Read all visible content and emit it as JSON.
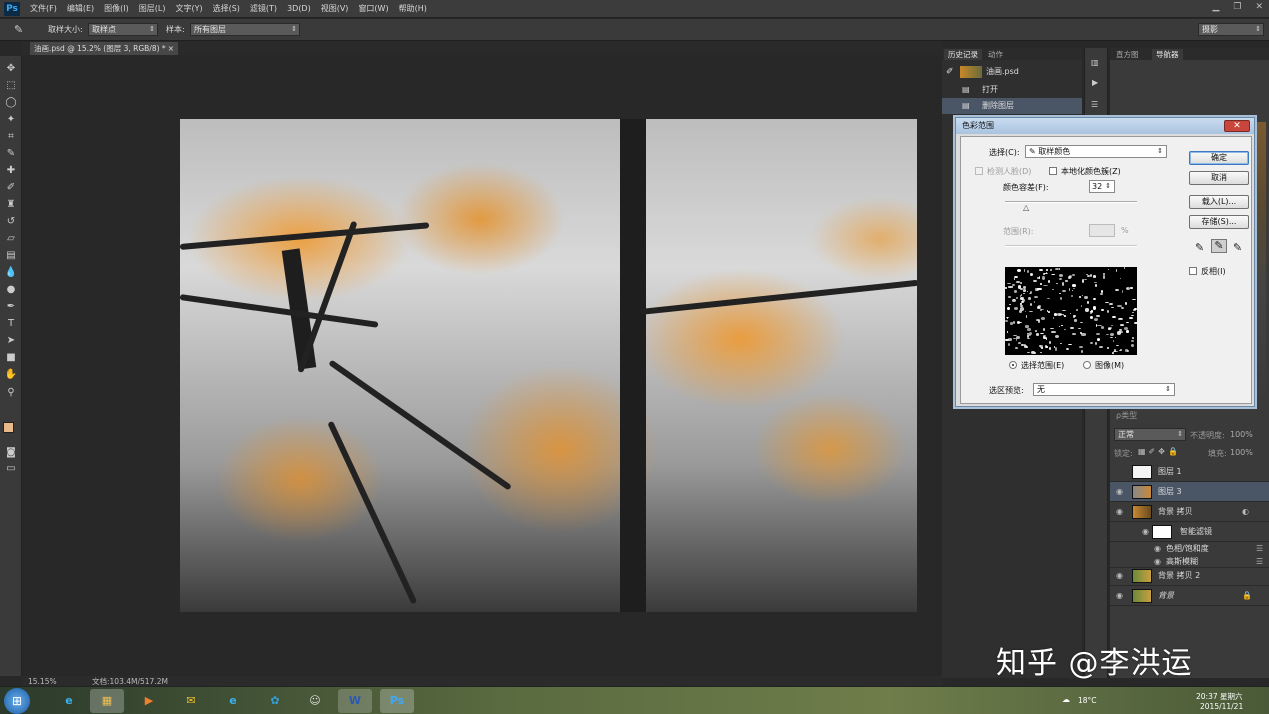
{
  "app": {
    "logo": "Ps",
    "menus": [
      "文件(F)",
      "编辑(E)",
      "图像(I)",
      "图层(L)",
      "文字(Y)",
      "选择(S)",
      "滤镜(T)",
      "3D(D)",
      "视图(V)",
      "窗口(W)",
      "帮助(H)"
    ],
    "window_controls": [
      "▁",
      "❐",
      "✕"
    ]
  },
  "options_bar": {
    "sample_size_label": "取样大小:",
    "sample_size_value": "取样点",
    "sample_label": "样本:",
    "sample_value": "所有图层",
    "workspace_value": "摄影"
  },
  "document": {
    "tab_title": "油画.psd @ 15.2% (图层 3, RGB/8) *",
    "close": "×",
    "zoom": "15.15%",
    "doc_size": "文档:103.4M/517.2M"
  },
  "history_panel": {
    "tabs": [
      "历史记录",
      "动作"
    ],
    "snapshot": "油画.psd",
    "items": [
      "打开",
      "删除图层"
    ]
  },
  "navigator_panel": {
    "tabs": [
      "直方图",
      "导航器"
    ]
  },
  "layers_panel": {
    "kind_label": "ρ类型",
    "blend_mode": "正常",
    "opacity_label": "不透明度:",
    "opacity_value": "100%",
    "lock_label": "锁定:",
    "fill_label": "填充:",
    "fill_value": "100%",
    "layers": [
      {
        "name": "图层 1"
      },
      {
        "name": "图层 3"
      },
      {
        "name": "背景 拷贝"
      },
      {
        "name": "智能滤镜"
      },
      {
        "name": "色相/饱和度"
      },
      {
        "name": "高斯模糊"
      },
      {
        "name": "背景 拷贝 2"
      },
      {
        "name": "背景"
      }
    ]
  },
  "dialog": {
    "title": "色彩范围",
    "close": "✕",
    "select_label": "选择(C):",
    "select_value": "取样颜色",
    "detect_faces": "检测人脸(D)",
    "localized": "本地化颜色簇(Z)",
    "fuzziness_label": "颜色容差(F):",
    "fuzziness_value": "32",
    "range_label": "范围(R):",
    "range_unit": "%",
    "preview_mode_selection": "选择范围(E)",
    "preview_mode_image": "图像(M)",
    "selection_preview_label": "选区预览:",
    "selection_preview_value": "无",
    "ok": "确定",
    "cancel": "取消",
    "load": "载入(L)...",
    "save": "存储(S)...",
    "invert": "反相(I)"
  },
  "taskbar": {
    "temperature": "18°C",
    "time": "20:37 星期六",
    "date": "2015/11/21"
  },
  "watermark": "知乎 @李洪运",
  "colors": {
    "foreground": "#e9b98a",
    "background": "#ffffff",
    "accent": "#4a5566"
  }
}
